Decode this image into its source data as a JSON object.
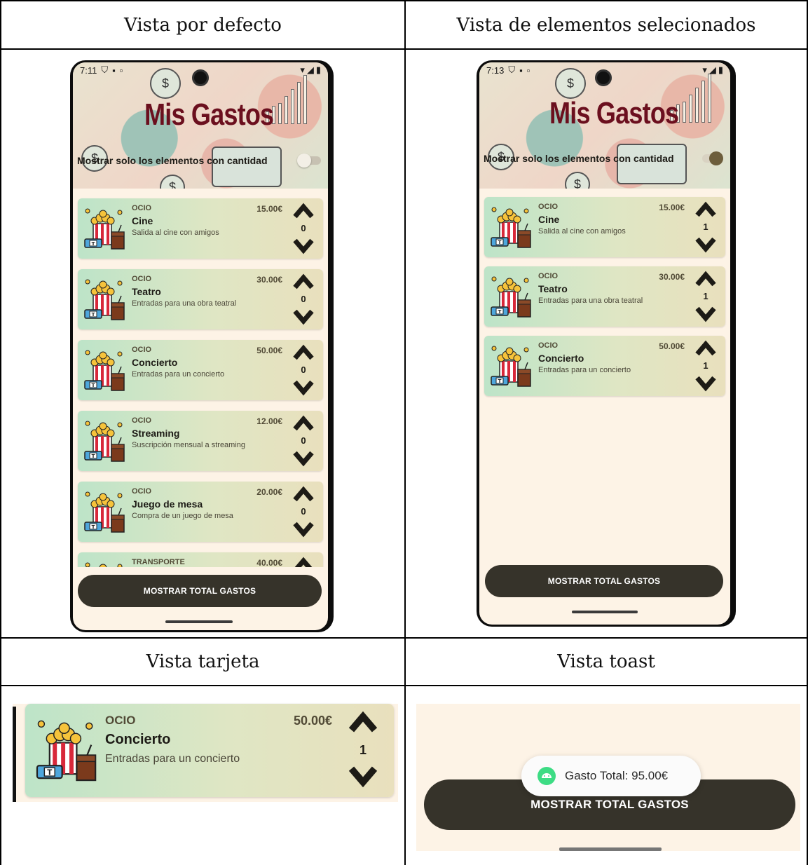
{
  "table": {
    "headers": [
      "Vista por defecto",
      "Vista de elementos selecionados",
      "Vista tarjeta",
      "Vista toast"
    ]
  },
  "phone_default": {
    "status_time": "7:11",
    "app_title": "Mis Gastos",
    "filter_label": "Mostrar solo los elementos con cantidad",
    "filter_on": false,
    "items": [
      {
        "category": "OCIO",
        "name": "Cine",
        "description": "Salida al cine con amigos",
        "price": "15.00€",
        "quantity": "0"
      },
      {
        "category": "OCIO",
        "name": "Teatro",
        "description": "Entradas para una obra teatral",
        "price": "30.00€",
        "quantity": "0"
      },
      {
        "category": "OCIO",
        "name": "Concierto",
        "description": "Entradas para un concierto",
        "price": "50.00€",
        "quantity": "0"
      },
      {
        "category": "OCIO",
        "name": "Streaming",
        "description": "Suscripción mensual a streaming",
        "price": "12.00€",
        "quantity": "0"
      },
      {
        "category": "OCIO",
        "name": "Juego de mesa",
        "description": "Compra de un juego de mesa",
        "price": "20.00€",
        "quantity": "0"
      },
      {
        "category": "TRANSPORTE",
        "name": "",
        "description": "",
        "price": "40.00€",
        "quantity": ""
      }
    ],
    "total_button": "MOSTRAR TOTAL GASTOS"
  },
  "phone_selected": {
    "status_time": "7:13",
    "app_title": "Mis Gastos",
    "filter_label": "Mostrar solo los elementos con cantidad",
    "filter_on": true,
    "items": [
      {
        "category": "OCIO",
        "name": "Cine",
        "description": "Salida al cine con amigos",
        "price": "15.00€",
        "quantity": "1"
      },
      {
        "category": "OCIO",
        "name": "Teatro",
        "description": "Entradas para una obra teatral",
        "price": "30.00€",
        "quantity": "1"
      },
      {
        "category": "OCIO",
        "name": "Concierto",
        "description": "Entradas para un concierto",
        "price": "50.00€",
        "quantity": "1"
      }
    ],
    "total_button": "MOSTRAR TOTAL GASTOS"
  },
  "card_view": {
    "category": "OCIO",
    "name": "Concierto",
    "description": "Entradas para un concierto",
    "price": "50.00€",
    "quantity": "1"
  },
  "toast_view": {
    "toast_text": "Gasto Total: 95.00€",
    "total_button": "MOSTRAR TOTAL GASTOS"
  },
  "colors": {
    "title": "#6b0f1e",
    "button": "#36332a",
    "screen_bg": "#fdf3e6",
    "toast_icon": "#3ddc84"
  }
}
